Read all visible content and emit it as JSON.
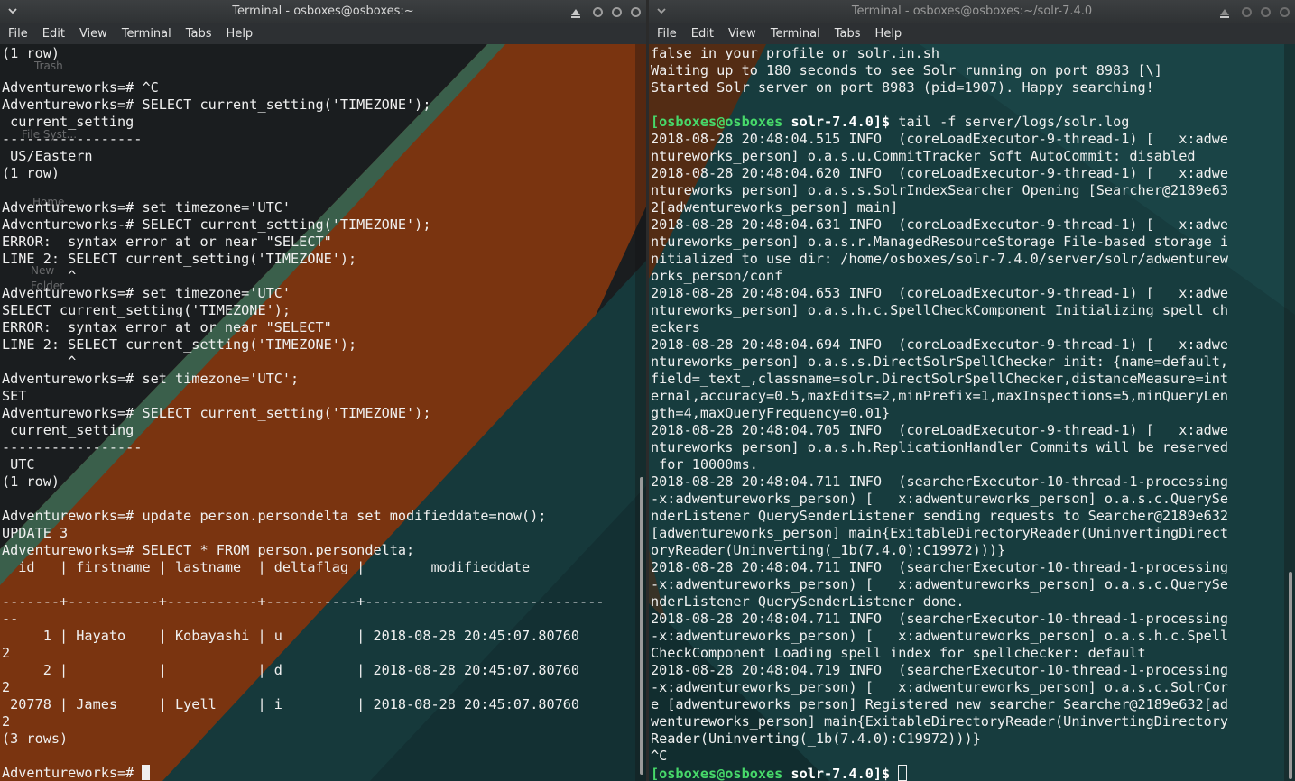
{
  "left_window": {
    "title": "Terminal - osboxes@osboxes:~",
    "menu": [
      "File",
      "Edit",
      "View",
      "Terminal",
      "Tabs",
      "Help"
    ],
    "desktop_labels": [
      "Trash",
      "File Syst...",
      "Home",
      "New",
      "Folder"
    ],
    "lines": [
      "(1 row)",
      "",
      "Adventureworks=# ^C",
      "Adventureworks=# SELECT current_setting('TIMEZONE');",
      " current_setting",
      "-----------------",
      " US/Eastern",
      "(1 row)",
      "",
      "Adventureworks=# set timezone='UTC'",
      "Adventureworks-# SELECT current_setting('TIMEZONE');",
      "ERROR:  syntax error at or near \"SELECT\"",
      "LINE 2: SELECT current_setting('TIMEZONE');",
      "        ^",
      "Adventureworks=# set timezone='UTC'",
      "SELECT current_setting('TIMEZONE');",
      "ERROR:  syntax error at or near \"SELECT\"",
      "LINE 2: SELECT current_setting('TIMEZONE');",
      "        ^",
      "Adventureworks=# set timezone='UTC';",
      "SET",
      "Adventureworks=# SELECT current_setting('TIMEZONE');",
      " current_setting",
      "-----------------",
      " UTC",
      "(1 row)",
      "",
      "Adventureworks=# update person.persondelta set modifieddate=now();",
      "UPDATE 3",
      "Adventureworks=# SELECT * FROM person.persondelta;",
      "  id   | firstname | lastname  | deltaflag |        modifieddate",
      "",
      "-------+-----------+-----------+-----------+-----------------------------",
      "--",
      "     1 | Hayato    | Kobayashi | u         | 2018-08-28 20:45:07.80760",
      "2",
      "     2 |           |           | d         | 2018-08-28 20:45:07.80760",
      "2",
      " 20778 | James     | Lyell     | i         | 2018-08-28 20:45:07.80760",
      "2",
      "(3 rows)",
      ""
    ],
    "prompt": "Adventureworks=# "
  },
  "right_window": {
    "title": "Terminal - osboxes@osboxes:~/solr-7.4.0",
    "menu": [
      "File",
      "Edit",
      "View",
      "Terminal",
      "Tabs",
      "Help"
    ],
    "lines_before_cmd": [
      "false in your profile or solr.in.sh",
      "Waiting up to 180 seconds to see Solr running on port 8983 [\\]",
      "Started Solr server on port 8983 (pid=1907). Happy searching!",
      ""
    ],
    "prompt_user": "[osboxes@osboxes",
    "prompt_dir": "solr-7.4.0]$",
    "command": " tail -f server/logs/solr.log",
    "log_lines": [
      "2018-08-28 20:48:04.515 INFO  (coreLoadExecutor-9-thread-1) [   x:adwe",
      "ntureworks_person] o.a.s.u.CommitTracker Soft AutoCommit: disabled",
      "2018-08-28 20:48:04.620 INFO  (coreLoadExecutor-9-thread-1) [   x:adwe",
      "ntureworks_person] o.a.s.s.SolrIndexSearcher Opening [Searcher@2189e63",
      "2[adwentureworks_person] main]",
      "2018-08-28 20:48:04.631 INFO  (coreLoadExecutor-9-thread-1) [   x:adwe",
      "ntureworks_person] o.a.s.r.ManagedResourceStorage File-based storage i",
      "nitialized to use dir: /home/osboxes/solr-7.4.0/server/solr/adwenturew",
      "orks_person/conf",
      "2018-08-28 20:48:04.653 INFO  (coreLoadExecutor-9-thread-1) [   x:adwe",
      "ntureworks_person] o.a.s.h.c.SpellCheckComponent Initializing spell ch",
      "eckers",
      "2018-08-28 20:48:04.694 INFO  (coreLoadExecutor-9-thread-1) [   x:adwe",
      "ntureworks_person] o.a.s.s.DirectSolrSpellChecker init: {name=default,",
      "field=_text_,classname=solr.DirectSolrSpellChecker,distanceMeasure=int",
      "ernal,accuracy=0.5,maxEdits=2,minPrefix=1,maxInspections=5,minQueryLen",
      "gth=4,maxQueryFrequency=0.01}",
      "2018-08-28 20:48:04.705 INFO  (coreLoadExecutor-9-thread-1) [   x:adwe",
      "ntureworks_person] o.a.s.h.ReplicationHandler Commits will be reserved",
      " for 10000ms.",
      "2018-08-28 20:48:04.711 INFO  (searcherExecutor-10-thread-1-processing",
      "-x:adwentureworks_person) [   x:adwentureworks_person] o.a.s.c.QuerySe",
      "nderListener QuerySenderListener sending requests to Searcher@2189e632",
      "[adwentureworks_person] main{ExitableDirectoryReader(UninvertingDirect",
      "oryReader(Uninverting(_1b(7.4.0):C19972)))}",
      "2018-08-28 20:48:04.711 INFO  (searcherExecutor-10-thread-1-processing",
      "-x:adwentureworks_person) [   x:adwentureworks_person] o.a.s.c.QuerySe",
      "nderListener QuerySenderListener done.",
      "2018-08-28 20:48:04.711 INFO  (searcherExecutor-10-thread-1-processing",
      "-x:adwentureworks_person) [   x:adwentureworks_person] o.a.s.h.c.Spell",
      "CheckComponent Loading spell index for spellchecker: default",
      "2018-08-28 20:48:04.719 INFO  (searcherExecutor-10-thread-1-processing",
      "-x:adwentureworks_person) [   x:adwentureworks_person] o.a.s.c.SolrCor",
      "e [adwentureworks_person] Registered new searcher Searcher@2189e632[ad",
      "wentureworks_person] main{ExitableDirectoryReader(UninvertingDirectory",
      "Reader(Uninverting(_1b(7.4.0):C19972)))}",
      "^C"
    ]
  },
  "colors": {
    "text": "#f0f0f0",
    "prompt_green": "#47d96a",
    "wallpaper_teal": "#1c4444",
    "wallpaper_orange": "#8a3a12"
  }
}
